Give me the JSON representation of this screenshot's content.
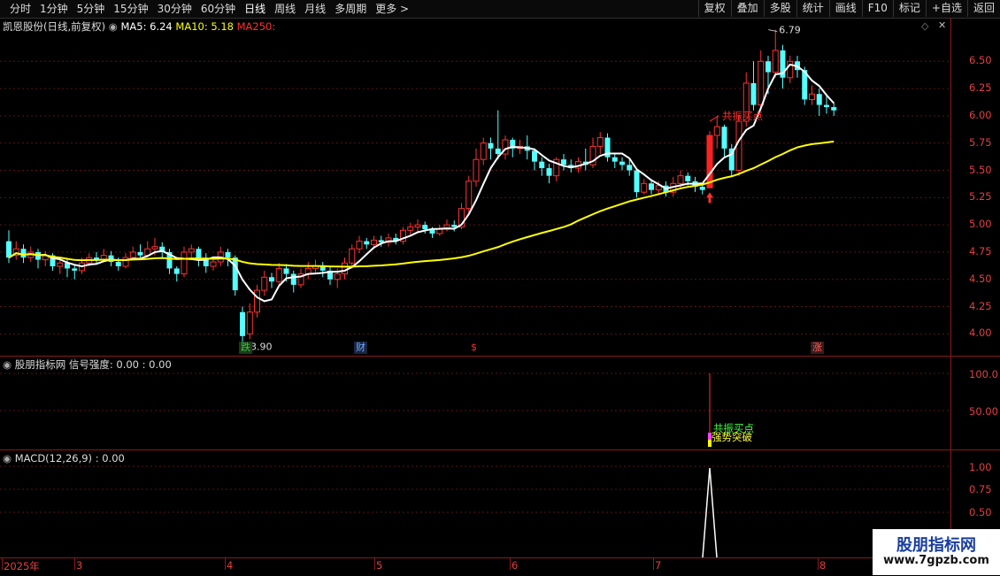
{
  "toolbar": {
    "periods": [
      "分时",
      "1分钟",
      "5分钟",
      "15分钟",
      "30分钟",
      "60分钟",
      "日线",
      "周线",
      "月线",
      "多周期",
      "更多 >"
    ],
    "active_period": "日线",
    "right_buttons": [
      "复权",
      "叠加",
      "多股",
      "统计",
      "画线",
      "F10",
      "标记",
      "+自选",
      "返回"
    ]
  },
  "main_panel": {
    "stock_title": "凯恩股份(日线,前复权)",
    "ma5_label": "MA5: 6.24",
    "ma10_label": "MA10: 5.18",
    "ma250_label": "MA250:",
    "y_ticks": [
      "6.50",
      "6.25",
      "6.00",
      "5.75",
      "5.50",
      "5.25",
      "5.00",
      "4.75",
      "4.50",
      "4.25",
      "4.00"
    ],
    "high_label": "6.79",
    "low_label": "3.90",
    "signal_label": "共振买点",
    "events": [
      {
        "text": "跌",
        "color": "#3cc83c",
        "bg": "#1b3a1b"
      },
      {
        "text": "财",
        "color": "#6aa8ff",
        "bg": "#1b2540"
      },
      {
        "text": "$",
        "color": "#ff3030",
        "bg": "transparent"
      },
      {
        "text": "涨",
        "color": "#ff6060",
        "bg": "#3a1b1b"
      }
    ],
    "colors": {
      "up": "#ff3232",
      "down": "#54ffff",
      "ma5": "#ffffff",
      "ma10": "#ffff00",
      "signal": "#ff2020"
    }
  },
  "indicator_panel": {
    "title": "股朋指标网 信号强度: 0.00 : 0.00",
    "y_ticks": [
      "100.0",
      "50.00"
    ],
    "label_signal": "共振买点",
    "label_break": "强势突破"
  },
  "macd_panel": {
    "title": "MACD(12,26,9) : 0.00",
    "y_ticks": [
      "1.00",
      "0.75",
      "0.50"
    ]
  },
  "x_axis": {
    "labels": [
      "2025年",
      "3",
      "4",
      "5",
      "6",
      "7",
      "8"
    ]
  },
  "watermark": {
    "line1": "股朋指标网",
    "line2": "www.7gpzb.com"
  },
  "chart_data": {
    "type": "candlestick",
    "y_range": [
      3.8,
      6.9
    ],
    "candles": [
      [
        4.85,
        4.7,
        4.95,
        4.65
      ],
      [
        4.72,
        4.78,
        4.85,
        4.68
      ],
      [
        4.78,
        4.7,
        4.82,
        4.65
      ],
      [
        4.7,
        4.75,
        4.8,
        4.66
      ],
      [
        4.75,
        4.68,
        4.78,
        4.6
      ],
      [
        4.68,
        4.72,
        4.76,
        4.62
      ],
      [
        4.72,
        4.62,
        4.74,
        4.58
      ],
      [
        4.62,
        4.65,
        4.7,
        4.55
      ],
      [
        4.65,
        4.6,
        4.68,
        4.52
      ],
      [
        4.6,
        4.58,
        4.63,
        4.5
      ],
      [
        4.58,
        4.65,
        4.7,
        4.55
      ],
      [
        4.65,
        4.7,
        4.74,
        4.62
      ],
      [
        4.7,
        4.68,
        4.75,
        4.64
      ],
      [
        4.68,
        4.72,
        4.78,
        4.66
      ],
      [
        4.72,
        4.66,
        4.76,
        4.62
      ],
      [
        4.66,
        4.62,
        4.7,
        4.58
      ],
      [
        4.62,
        4.7,
        4.74,
        4.6
      ],
      [
        4.7,
        4.75,
        4.8,
        4.68
      ],
      [
        4.75,
        4.72,
        4.82,
        4.7
      ],
      [
        4.72,
        4.78,
        4.85,
        4.7
      ],
      [
        4.78,
        4.8,
        4.88,
        4.72
      ],
      [
        4.8,
        4.75,
        4.84,
        4.7
      ],
      [
        4.75,
        4.6,
        4.78,
        4.55
      ],
      [
        4.6,
        4.55,
        4.62,
        4.48
      ],
      [
        4.55,
        4.75,
        4.8,
        4.52
      ],
      [
        4.75,
        4.78,
        4.82,
        4.7
      ],
      [
        4.78,
        4.7,
        4.8,
        4.62
      ],
      [
        4.7,
        4.62,
        4.74,
        4.56
      ],
      [
        4.62,
        4.66,
        4.7,
        4.58
      ],
      [
        4.66,
        4.75,
        4.8,
        4.62
      ],
      [
        4.75,
        4.7,
        4.78,
        4.62
      ],
      [
        4.7,
        4.4,
        4.72,
        4.35
      ],
      [
        4.2,
        3.98,
        4.25,
        3.9
      ],
      [
        4.0,
        4.2,
        4.28,
        3.95
      ],
      [
        4.2,
        4.4,
        4.45,
        4.15
      ],
      [
        4.4,
        4.52,
        4.58,
        4.35
      ],
      [
        4.52,
        4.48,
        4.56,
        4.42
      ],
      [
        4.48,
        4.6,
        4.65,
        4.45
      ],
      [
        4.6,
        4.55,
        4.64,
        4.48
      ],
      [
        4.55,
        4.45,
        4.58,
        4.38
      ],
      [
        4.45,
        4.55,
        4.6,
        4.42
      ],
      [
        4.55,
        4.6,
        4.66,
        4.5
      ],
      [
        4.6,
        4.62,
        4.68,
        4.55
      ],
      [
        4.62,
        4.58,
        4.66,
        4.52
      ],
      [
        4.58,
        4.5,
        4.62,
        4.45
      ],
      [
        4.5,
        4.55,
        4.6,
        4.42
      ],
      [
        4.55,
        4.65,
        4.7,
        4.5
      ],
      [
        4.65,
        4.78,
        4.82,
        4.6
      ],
      [
        4.78,
        4.85,
        4.9,
        4.74
      ],
      [
        4.85,
        4.82,
        4.88,
        4.78
      ],
      [
        4.82,
        4.86,
        4.9,
        4.78
      ],
      [
        4.86,
        4.84,
        4.9,
        4.8
      ],
      [
        4.84,
        4.88,
        4.92,
        4.8
      ],
      [
        4.88,
        4.85,
        4.92,
        4.82
      ],
      [
        4.85,
        4.95,
        4.98,
        4.82
      ],
      [
        4.95,
        4.98,
        5.02,
        4.9
      ],
      [
        4.98,
        5.0,
        5.05,
        4.94
      ],
      [
        5.0,
        4.96,
        5.03,
        4.92
      ],
      [
        4.96,
        4.92,
        4.98,
        4.88
      ],
      [
        4.92,
        4.96,
        5.0,
        4.9
      ],
      [
        4.96,
        5.0,
        5.05,
        4.94
      ],
      [
        5.0,
        4.98,
        5.04,
        4.94
      ],
      [
        4.98,
        5.15,
        5.2,
        4.96
      ],
      [
        5.15,
        5.4,
        5.45,
        5.1
      ],
      [
        5.4,
        5.6,
        5.7,
        5.35
      ],
      [
        5.6,
        5.75,
        5.8,
        5.55
      ],
      [
        5.75,
        5.7,
        5.8,
        5.6
      ],
      [
        5.7,
        5.65,
        6.05,
        5.6
      ],
      [
        5.65,
        5.78,
        5.82,
        5.6
      ],
      [
        5.78,
        5.7,
        5.8,
        5.62
      ],
      [
        5.7,
        5.72,
        5.78,
        5.65
      ],
      [
        5.72,
        5.68,
        5.82,
        5.6
      ],
      [
        5.68,
        5.58,
        5.7,
        5.5
      ],
      [
        5.58,
        5.52,
        5.62,
        5.45
      ],
      [
        5.52,
        5.45,
        5.56,
        5.38
      ],
      [
        5.45,
        5.6,
        5.62,
        5.4
      ],
      [
        5.6,
        5.55,
        5.65,
        5.5
      ],
      [
        5.55,
        5.52,
        5.6,
        5.48
      ],
      [
        5.52,
        5.58,
        5.62,
        5.48
      ],
      [
        5.58,
        5.55,
        5.7,
        5.5
      ],
      [
        5.55,
        5.72,
        5.8,
        5.52
      ],
      [
        5.72,
        5.8,
        5.85,
        5.65
      ],
      [
        5.8,
        5.62,
        5.84,
        5.58
      ],
      [
        5.62,
        5.58,
        5.66,
        5.52
      ],
      [
        5.58,
        5.55,
        5.62,
        5.5
      ],
      [
        5.55,
        5.5,
        5.6,
        5.45
      ],
      [
        5.5,
        5.3,
        5.52,
        5.25
      ],
      [
        5.3,
        5.38,
        5.42,
        5.28
      ],
      [
        5.38,
        5.32,
        5.42,
        5.28
      ],
      [
        5.32,
        5.36,
        5.4,
        5.28
      ],
      [
        5.36,
        5.3,
        5.4,
        5.26
      ],
      [
        5.3,
        5.38,
        5.44,
        5.26
      ],
      [
        5.38,
        5.45,
        5.5,
        5.34
      ],
      [
        5.45,
        5.4,
        5.48,
        5.36
      ],
      [
        5.4,
        5.35,
        5.44,
        5.3
      ],
      [
        5.35,
        5.32,
        5.38,
        5.28
      ],
      [
        5.34,
        5.82,
        5.86,
        5.34
      ],
      [
        5.82,
        5.9,
        6.0,
        5.7
      ],
      [
        5.9,
        5.7,
        5.92,
        5.62
      ],
      [
        5.7,
        5.5,
        5.74,
        5.45
      ],
      [
        5.5,
        5.95,
        6.0,
        5.45
      ],
      [
        5.95,
        6.3,
        6.4,
        5.9
      ],
      [
        6.3,
        6.1,
        6.5,
        6.05
      ],
      [
        6.1,
        6.5,
        6.6,
        6.05
      ],
      [
        6.5,
        6.4,
        6.55,
        6.2
      ],
      [
        6.4,
        6.6,
        6.79,
        6.35
      ],
      [
        6.6,
        6.35,
        6.65,
        6.25
      ],
      [
        6.35,
        6.5,
        6.55,
        6.3
      ],
      [
        6.5,
        6.42,
        6.55,
        6.35
      ],
      [
        6.42,
        6.15,
        6.45,
        6.1
      ],
      [
        6.15,
        6.2,
        6.28,
        6.1
      ],
      [
        6.2,
        6.1,
        6.25,
        6.0
      ],
      [
        6.1,
        6.08,
        6.18,
        6.02
      ],
      [
        6.08,
        6.05,
        6.12,
        6.0
      ]
    ]
  }
}
